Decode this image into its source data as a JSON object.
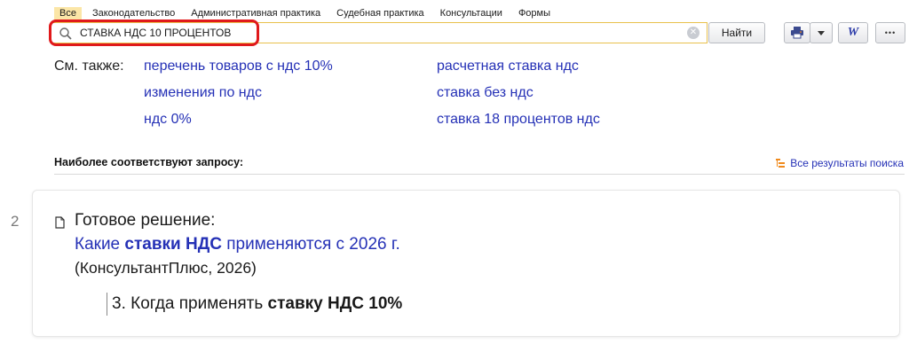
{
  "tabs": [
    {
      "label": "Все",
      "active": true
    },
    {
      "label": "Законодательство",
      "active": false
    },
    {
      "label": "Административная практика",
      "active": false
    },
    {
      "label": "Судебная практика",
      "active": false
    },
    {
      "label": "Консультации",
      "active": false
    },
    {
      "label": "Формы",
      "active": false
    }
  ],
  "search": {
    "value": "СТАВКА НДС 10 ПРОЦЕНТОВ",
    "button_label": "Найти"
  },
  "toolbar": {
    "word_label": "W",
    "more_label": "•••"
  },
  "see_also": {
    "label": "См. также:",
    "links": [
      "перечень товаров с ндс 10%",
      "изменения по ндс",
      "ндс 0%",
      "расчетная ставка ндс",
      "ставка без ндс",
      "ставка 18 процентов ндс"
    ]
  },
  "results": {
    "section_title": "Наиболее соответствуют запросу:",
    "all_results_label": "Все результаты поиска",
    "items": [
      {
        "number": "2",
        "type_label": "Готовое решение:",
        "title_prefix": "Какие ",
        "title_bold": "ставки НДС",
        "title_suffix": " применяются с 2026 г.",
        "source": "(КонсультантПлюс, 2026)",
        "excerpt_prefix": "3. Когда применять ",
        "excerpt_bold": "ставку НДС 10%"
      }
    ]
  },
  "colors": {
    "link": "#2531b6",
    "highlight": "#e0191b",
    "active_tab": "#fbe6a7",
    "accent": "#f08a1c"
  }
}
